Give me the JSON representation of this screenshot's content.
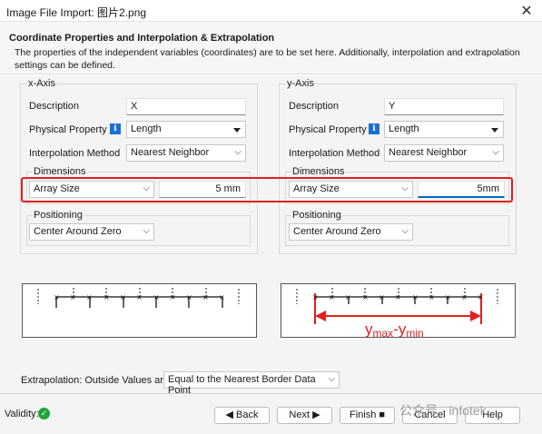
{
  "window": {
    "title": "Image File Import: 图片2.png",
    "close_glyph": "✕"
  },
  "header": {
    "title": "Coordinate Properties and Interpolation & Extrapolation",
    "description": "The properties of the independent variables (coordinates) are to be set here. Additionally, interpolation and extrapolation settings can be defined."
  },
  "x_axis": {
    "group_label": "x-Axis",
    "description_label": "Description",
    "description_value": "X",
    "physical_property_label": "Physical Property",
    "physical_property_value": "Length",
    "interpolation_label": "Interpolation Method",
    "interpolation_value": "Nearest Neighbor",
    "dimensions_label": "Dimensions",
    "dimensions_mode": "Array Size",
    "dimensions_value": "5 mm",
    "positioning_label": "Positioning",
    "positioning_value": "Center Around Zero"
  },
  "y_axis": {
    "group_label": "y-Axis",
    "description_label": "Description",
    "description_value": "Y",
    "physical_property_label": "Physical Property",
    "physical_property_value": "Length",
    "interpolation_label": "Interpolation Method",
    "interpolation_value": "Nearest Neighbor",
    "dimensions_label": "Dimensions",
    "dimensions_mode": "Array Size",
    "dimensions_value": "5mm",
    "positioning_label": "Positioning",
    "positioning_value": "Center Around Zero"
  },
  "diagram_right": {
    "label_main": "y",
    "sub_max": "max",
    "dash": "-",
    "label_main2": "y",
    "sub_min": "min"
  },
  "extrapolation": {
    "label": "Extrapolation: Outside Values are",
    "value": "Equal to the Nearest Border Data Point"
  },
  "footer": {
    "validity_label": "Validity:",
    "back": "◀  Back",
    "next": "Next  ▶",
    "finish": "Finish  ■",
    "cancel": "Cancel",
    "help": "Help",
    "watermark": "公众号 · infotek"
  },
  "colors": {
    "highlight": "#e02020",
    "accent": "#1a6fd1",
    "ok": "#22a33a",
    "diagram_arrow": "#e02020"
  }
}
